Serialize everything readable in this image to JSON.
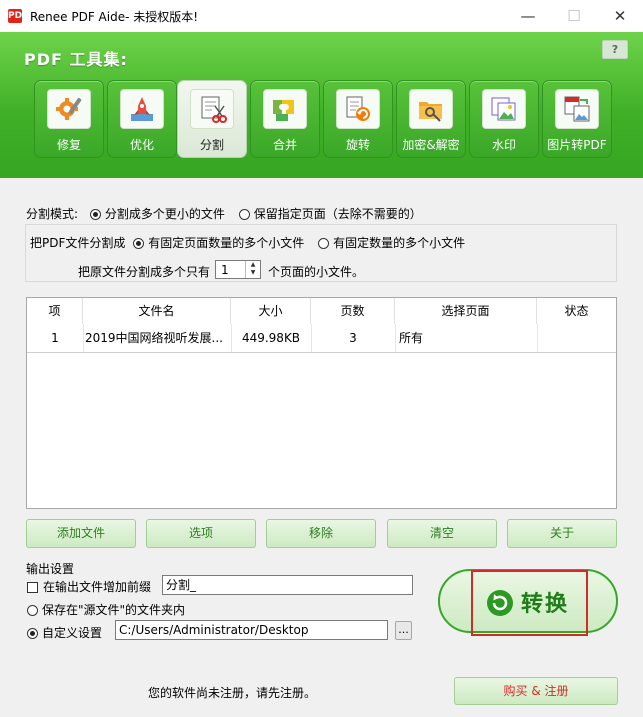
{
  "window": {
    "app_icon": "PDF",
    "title": "Renee PDF Aide- 未授权版本!",
    "controls": {
      "minimize": "—",
      "maximize": "☐",
      "close": "✕"
    }
  },
  "header": {
    "title": "PDF 工具集:",
    "help": "?",
    "tools": [
      {
        "id": "repair",
        "label": "修复",
        "icon": "gear-repair-icon",
        "active": false
      },
      {
        "id": "optimize",
        "label": "优化",
        "icon": "rocket-icon",
        "active": false
      },
      {
        "id": "split",
        "label": "分割",
        "icon": "scissors-document-icon",
        "active": true
      },
      {
        "id": "merge",
        "label": "合并",
        "icon": "puzzle-icon",
        "active": false
      },
      {
        "id": "rotate",
        "label": "旋转",
        "icon": "rotate-document-icon",
        "active": false
      },
      {
        "id": "encrypt",
        "label": "加密&解密",
        "icon": "lock-folder-icon",
        "active": false
      },
      {
        "id": "watermark",
        "label": "水印",
        "icon": "watermark-image-icon",
        "active": false
      },
      {
        "id": "img2pdf",
        "label": "图片转PDF",
        "icon": "image-to-pdf-icon",
        "active": false
      }
    ]
  },
  "split": {
    "mode_label": "分割模式:",
    "mode_options": [
      "分割成多个更小的文件",
      "保留指定页面（去除不需要的）"
    ],
    "split_label": "把PDF文件分割成",
    "split_options": [
      "有固定页面数量的多个小文件",
      "有固定数量的多个小文件"
    ],
    "pages_prefix": "把原文件分割成多个只有",
    "pages_value": "1",
    "pages_suffix": "个页面的小文件。",
    "spin_up": "▲",
    "spin_down": "▼"
  },
  "table": {
    "headers": [
      "项",
      "文件名",
      "大小",
      "页数",
      "选择页面",
      "状态"
    ],
    "rows": [
      {
        "index": "1",
        "filename": "2019中国网络视听发展...",
        "size": "449.98KB",
        "pages": "3",
        "selection": "所有",
        "status": ""
      }
    ]
  },
  "actions": {
    "add_file": "添加文件",
    "options": "选项",
    "remove": "移除",
    "clear": "清空",
    "about": "关于"
  },
  "output": {
    "section_label": "输出设置",
    "prefix_label": "在输出文件增加前缀",
    "prefix_value": "分割_",
    "save_source_label": "保存在\"源文件\"的文件夹内",
    "custom_label": "自定义设置",
    "custom_path": "C:/Users/Administrator/Desktop",
    "browse": "..."
  },
  "convert": {
    "label": "转换"
  },
  "footer": {
    "message": "您的软件尚未注册，请先注册。",
    "buy_label": "购买 & 注册"
  },
  "colors": {
    "header_green": "#40b028",
    "button_text_green": "#2f7d22",
    "highlight_red": "#d42a2a",
    "convert_green": "#1e7d16"
  }
}
